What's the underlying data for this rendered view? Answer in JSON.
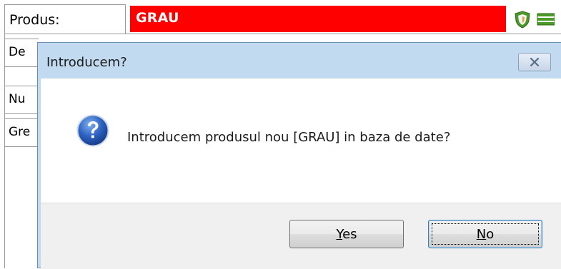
{
  "form": {
    "produs_label": "Produs:",
    "produs_value": "GRAU",
    "side_rows": [
      "De",
      "Nu",
      "Gre"
    ]
  },
  "dialog": {
    "title": "Introducem?",
    "message": "Introducem produsul nou [GRAU] in baza de date?",
    "yes_label": "Yes",
    "yes_mnemonic": "Y",
    "yes_rest": "es",
    "no_label": "No",
    "no_mnemonic": "N",
    "no_rest": "o"
  },
  "icons": {
    "toolbar_1": "green-shield-icon",
    "toolbar_2": "green-list-icon",
    "dialog": "question-icon",
    "close": "close-icon"
  },
  "colors": {
    "produs_field": "#ff0000",
    "dialog_frame": "#c2daf0",
    "button_area": "#f0f0f0"
  }
}
